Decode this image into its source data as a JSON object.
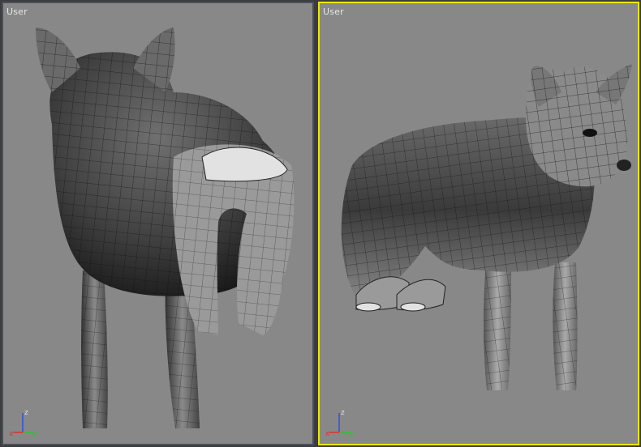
{
  "viewports": [
    {
      "label": "User",
      "active": false,
      "model": "wolf-back-view",
      "axes": {
        "x": "x",
        "y": "y",
        "z": "z"
      }
    },
    {
      "label": "User",
      "active": true,
      "model": "wolf-three-quarter-view",
      "axes": {
        "x": "x",
        "y": "y",
        "z": "z"
      }
    }
  ],
  "colors": {
    "viewport_bg": "#888888",
    "active_border": "#e8e800",
    "inactive_border": "#4a5058",
    "axis_x": "#e03030",
    "axis_y": "#30c030",
    "axis_z": "#3050e0"
  }
}
